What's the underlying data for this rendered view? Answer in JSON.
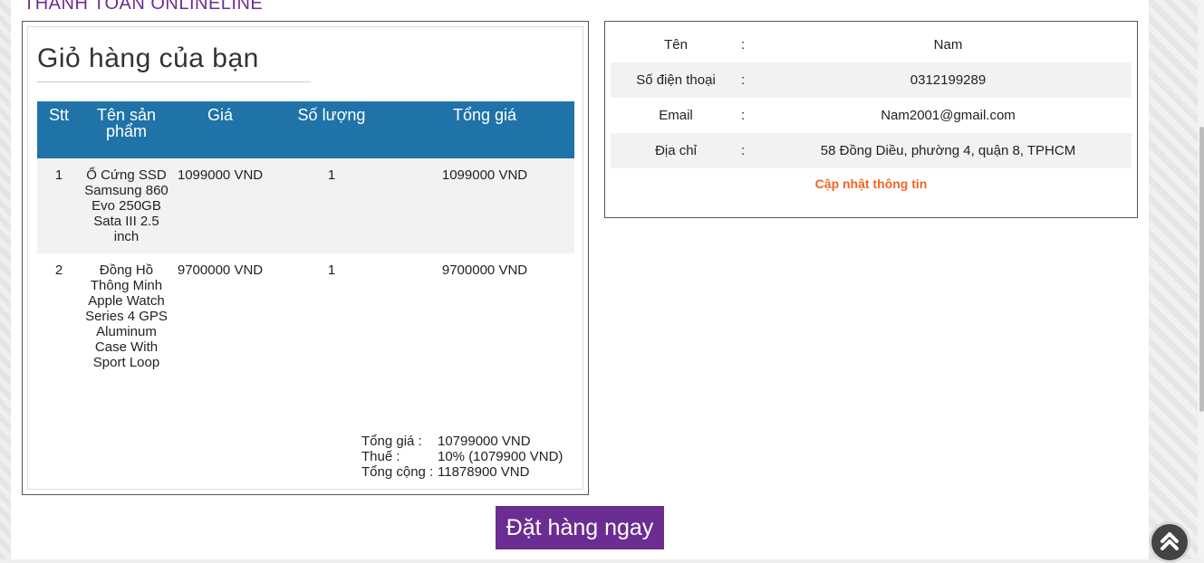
{
  "page": {
    "heading": "THANH TOÁN ONLINELINE"
  },
  "cart": {
    "title": "Giỏ hàng của bạn",
    "headers": [
      "Stt",
      "Tên sản phẩm",
      "Giá",
      "Số lượng",
      "Tổng giá"
    ],
    "rows": [
      {
        "stt": "1",
        "name": "Ổ Cứng SSD Samsung 860 Evo 250GB Sata III 2.5 inch",
        "price": "1099000 VND",
        "qty": "1",
        "total": "1099000 VND"
      },
      {
        "stt": "2",
        "name": "Đồng Hồ Thông Minh Apple Watch Series 4 GPS Aluminum Case With Sport Loop",
        "price": "9700000 VND",
        "qty": "1",
        "total": "9700000 VND"
      }
    ],
    "summary": {
      "subtotal_label": "Tổng giá :",
      "subtotal_value": "10799000 VND",
      "tax_label": "Thuế :",
      "tax_value": "10% (1079900 VND)",
      "grand_label": "Tổng cộng :",
      "grand_value": "11878900 VND"
    },
    "order_button": "Đặt hàng ngay"
  },
  "customer": {
    "fields": [
      {
        "label": "Tên",
        "value": "Nam"
      },
      {
        "label": "Số điện thoại",
        "value": "0312199289"
      },
      {
        "label": "Email",
        "value": "Nam2001@gmail.com"
      },
      {
        "label": "Địa chỉ",
        "value": "58 Đồng Diều, phường 4, quận 8, TPHCM"
      }
    ],
    "separator": ":",
    "update_link": "Cập nhật thông tin"
  },
  "colors": {
    "accent": "#6b2d91",
    "table_header": "#1f73a8",
    "link": "#f26522"
  },
  "icons": {
    "scroll_top": "chevron-double-up-icon"
  }
}
